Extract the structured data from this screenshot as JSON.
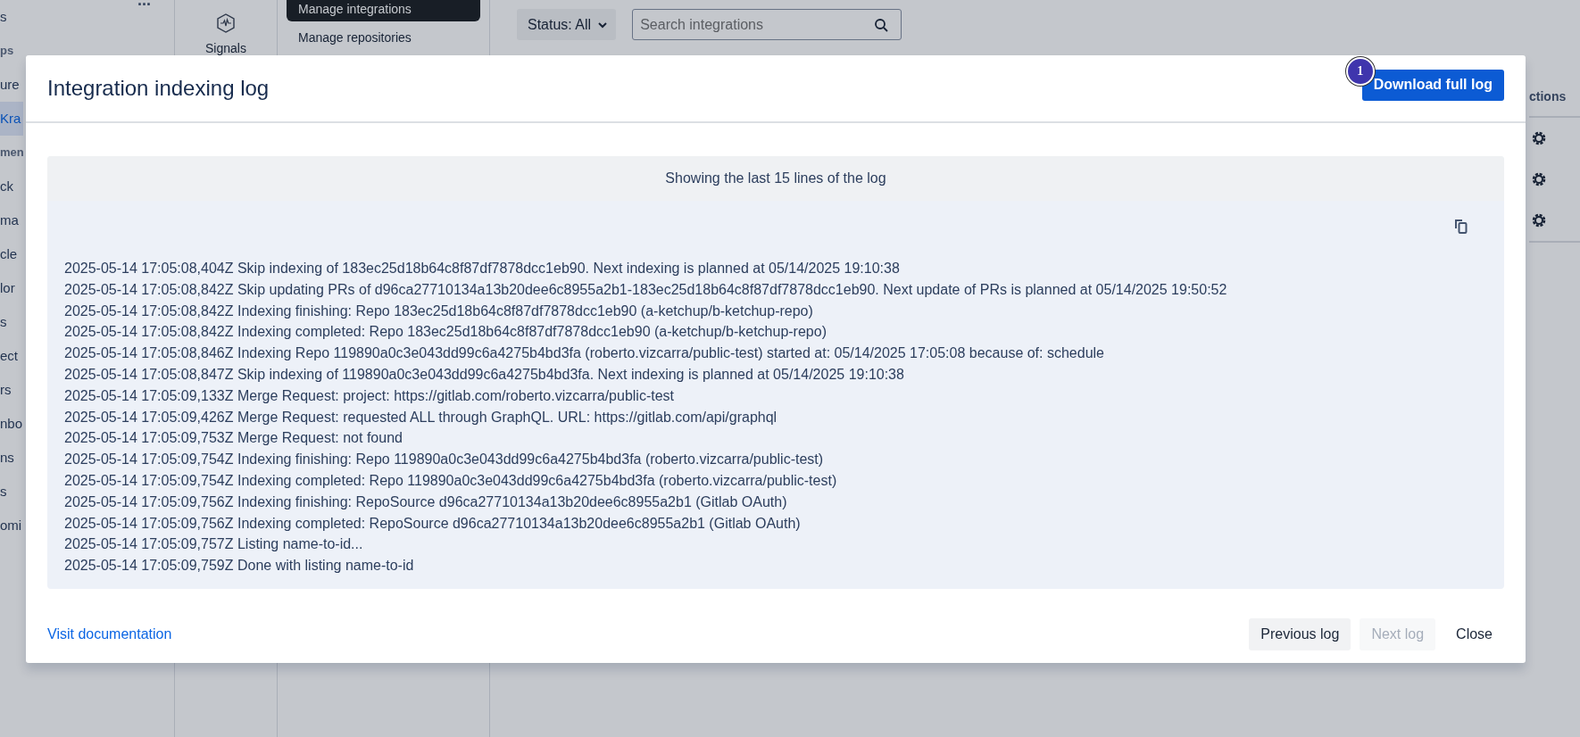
{
  "sidebar": {
    "more": "...",
    "items": [
      {
        "label": "s",
        "kind": "item",
        "selected": false
      },
      {
        "label": "ps",
        "kind": "header",
        "selected": false
      },
      {
        "label": "ure",
        "kind": "item",
        "selected": false
      },
      {
        "label": "Kra",
        "kind": "item",
        "selected": true
      },
      {
        "label": "men",
        "kind": "header",
        "selected": false
      },
      {
        "label": "ck",
        "kind": "item",
        "selected": false
      },
      {
        "label": "ma",
        "kind": "item",
        "selected": false
      },
      {
        "label": "cle",
        "kind": "item",
        "selected": false
      },
      {
        "label": "lor",
        "kind": "item",
        "selected": false
      },
      {
        "label": "s",
        "kind": "item",
        "selected": false
      },
      {
        "label": "ect",
        "kind": "item",
        "selected": false
      },
      {
        "label": "rs",
        "kind": "item",
        "selected": false
      },
      {
        "label": "nbo",
        "kind": "item",
        "selected": false
      },
      {
        "label": "ns",
        "kind": "item",
        "selected": false
      },
      {
        "label": "s",
        "kind": "item",
        "selected": false
      },
      {
        "label": "omi",
        "kind": "item",
        "selected": false
      }
    ]
  },
  "rail": {
    "label": "Signals"
  },
  "submenu": [
    {
      "label": "Manage integrations",
      "selected": true
    },
    {
      "label": "Manage repositories",
      "selected": false
    }
  ],
  "toolbar": {
    "status_filter": "Status: All",
    "search": {
      "placeholder": "Search integrations"
    }
  },
  "table": {
    "column_header": "ctions"
  },
  "modal": {
    "title": "Integration indexing log",
    "badge": "1",
    "download_button": "Download full log",
    "log_header": "Showing the last 15 lines of the log",
    "lines": [
      "2025-05-14 17:05:08,404Z Skip indexing of 183ec25d18b64c8f87df7878dcc1eb90. Next indexing is planned at 05/14/2025 19:10:38",
      "2025-05-14 17:05:08,842Z Skip updating PRs of d96ca27710134a13b20dee6c8955a2b1-183ec25d18b64c8f87df7878dcc1eb90. Next update of PRs is planned at 05/14/2025 19:50:52",
      "2025-05-14 17:05:08,842Z Indexing finishing: Repo 183ec25d18b64c8f87df7878dcc1eb90 (a-ketchup/b-ketchup-repo)",
      "2025-05-14 17:05:08,842Z Indexing completed: Repo 183ec25d18b64c8f87df7878dcc1eb90 (a-ketchup/b-ketchup-repo)",
      "2025-05-14 17:05:08,846Z Indexing Repo 119890a0c3e043dd99c6a4275b4bd3fa (roberto.vizcarra/public-test) started at: 05/14/2025 17:05:08 because of: schedule",
      "2025-05-14 17:05:08,847Z Skip indexing of 119890a0c3e043dd99c6a4275b4bd3fa. Next indexing is planned at 05/14/2025 19:10:38",
      "2025-05-14 17:05:09,133Z Merge Request: project: https://gitlab.com/roberto.vizcarra/public-test",
      "2025-05-14 17:05:09,426Z Merge Request: requested ALL through GraphQL. URL: https://gitlab.com/api/graphql",
      "2025-05-14 17:05:09,753Z Merge Request: not found",
      "2025-05-14 17:05:09,754Z Indexing finishing: Repo 119890a0c3e043dd99c6a4275b4bd3fa (roberto.vizcarra/public-test)",
      "2025-05-14 17:05:09,754Z Indexing completed: Repo 119890a0c3e043dd99c6a4275b4bd3fa (roberto.vizcarra/public-test)",
      "2025-05-14 17:05:09,756Z Indexing finishing: RepoSource d96ca27710134a13b20dee6c8955a2b1 (Gitlab OAuth)",
      "2025-05-14 17:05:09,756Z Indexing completed: RepoSource d96ca27710134a13b20dee6c8955a2b1 (Gitlab OAuth)",
      "2025-05-14 17:05:09,757Z Listing name-to-id...",
      "2025-05-14 17:05:09,759Z Done with listing name-to-id"
    ],
    "doc_link": "Visit documentation",
    "buttons": [
      {
        "label": "Previous log",
        "kind": "secondary",
        "disabled": false
      },
      {
        "label": "Next log",
        "kind": "secondary",
        "disabled": true
      },
      {
        "label": "Close",
        "kind": "subtle",
        "disabled": false
      }
    ]
  }
}
